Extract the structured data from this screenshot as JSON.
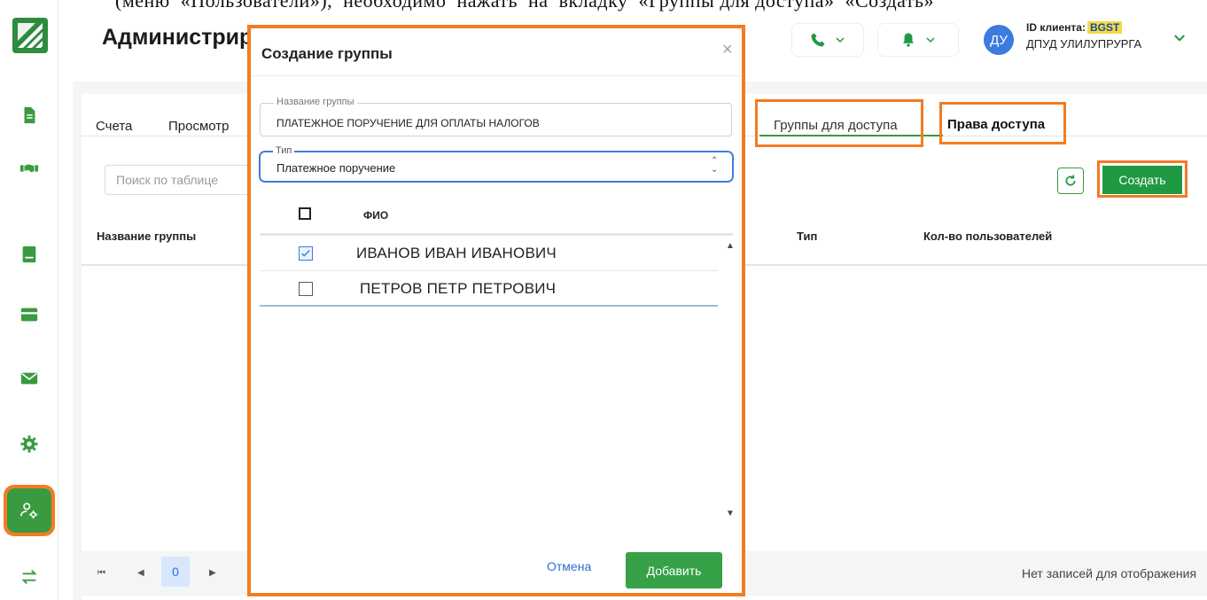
{
  "top_cut_text": "(меню  «Пользователи»),  необходимо  нажать  на  вкладку  «Группы для доступа»  «Создать»",
  "brand": {
    "accent": "#3a9a3f",
    "highlight": "#f37c22"
  },
  "sidebar": {
    "items": [
      {
        "name": "document-icon"
      },
      {
        "name": "handshake-icon"
      },
      {
        "name": "book-icon"
      },
      {
        "name": "card-icon"
      },
      {
        "name": "mail-icon"
      },
      {
        "name": "gear-icon"
      },
      {
        "name": "admin-icon"
      },
      {
        "name": "transfer-icon"
      }
    ]
  },
  "header": {
    "title": "Администрирование",
    "client_id_label": "ID клиента:",
    "client_id": "BGST",
    "client_name": "ДПУД УЛИЛУПРУРГА",
    "avatar": "ДУ"
  },
  "tabs": {
    "accounts": "Счета",
    "view": "Просмотр",
    "groups": "Группы для доступа",
    "rights": "Права доступа"
  },
  "search": {
    "placeholder": "Поиск по таблице"
  },
  "toolbar": {
    "create": "Создать"
  },
  "table": {
    "columns": {
      "name": "Название группы",
      "type": "Тип",
      "users": "Кол-во пользователей"
    },
    "empty_text": "Нет записей для отображения"
  },
  "pager": {
    "page": "0"
  },
  "modal": {
    "title": "Создание группы",
    "close": "×",
    "name_label": "Название группы",
    "name_value": "ПЛАТЕЖНОЕ ПОРУЧЕНИЕ ДЛЯ ОПЛАТЫ НАЛОГОВ",
    "type_label": "Тип",
    "type_value": "Платежное поручение",
    "fio_header": "ФИО",
    "users": [
      {
        "name": "ИВАНОВ ИВАН ИВАНОВИЧ",
        "checked": true
      },
      {
        "name": "ПЕТРОВ ПЕТР ПЕТРОВИЧ",
        "checked": false
      }
    ],
    "cancel": "Отмена",
    "add": "Добавить"
  }
}
